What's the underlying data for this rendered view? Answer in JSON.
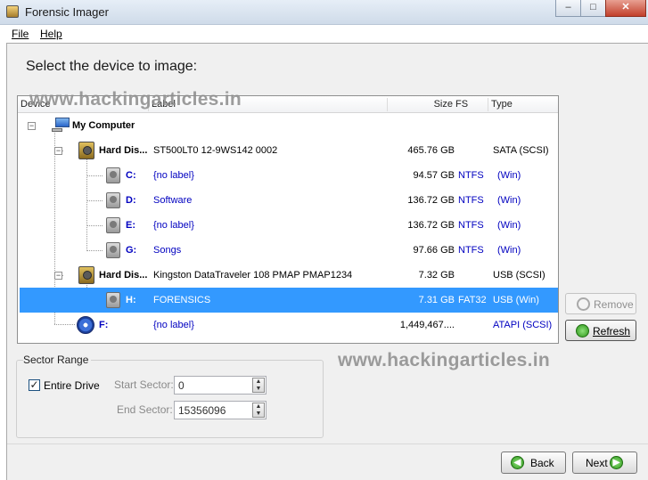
{
  "window": {
    "title": "Forensic Imager",
    "minimize": "–",
    "maximize": "□",
    "close": "✕"
  },
  "menu": {
    "file": "File",
    "help": "Help"
  },
  "heading": "Select the device to image:",
  "list": {
    "columns": {
      "device": "Device",
      "label": "Label",
      "size": "Size",
      "fs": "FS",
      "type": "Type"
    },
    "rows": [
      {
        "device": "My Computer",
        "label": "",
        "size": "",
        "fs": "",
        "type": "",
        "icon": "computer-icon",
        "expander": "−"
      },
      {
        "device": "Hard Dis...",
        "label": "ST500LT0 12-9WS142 0002",
        "size": "465.76 GB",
        "fs": "",
        "type": "SATA (SCSI)",
        "icon": "hard-disk-icon",
        "expander": "−"
      },
      {
        "device": "C:",
        "label": "{no label}",
        "size": "94.57 GB",
        "fs": "NTFS",
        "type": "(Win)",
        "icon": "volume-icon"
      },
      {
        "device": "D:",
        "label": "Software",
        "size": "136.72 GB",
        "fs": "NTFS",
        "type": "(Win)",
        "icon": "volume-icon"
      },
      {
        "device": "E:",
        "label": "{no label}",
        "size": "136.72 GB",
        "fs": "NTFS",
        "type": "(Win)",
        "icon": "volume-icon"
      },
      {
        "device": "G:",
        "label": "Songs",
        "size": "97.66 GB",
        "fs": "NTFS",
        "type": "(Win)",
        "icon": "volume-icon"
      },
      {
        "device": "Hard Dis...",
        "label": "Kingston DataTraveler 108 PMAP PMAP1234",
        "size": "7.32 GB",
        "fs": "",
        "type": "USB (SCSI)",
        "icon": "hard-disk-icon",
        "expander": "−"
      },
      {
        "device": "H:",
        "label": "FORENSICS",
        "size": "7.31 GB",
        "fs": "FAT32",
        "type": "USB (Win)",
        "icon": "volume-icon",
        "selected": true
      },
      {
        "device": "F:",
        "label": "{no label}",
        "size": "1,449,467....",
        "fs": "",
        "type": "ATAPI (SCSI)",
        "icon": "cd-drive-icon"
      }
    ]
  },
  "buttons": {
    "remove": "Remove",
    "refresh": "Refresh",
    "back": "Back",
    "next": "Next"
  },
  "watermark": "www.hackingarticles.in",
  "sector_range": {
    "title": "Sector Range",
    "entire_drive_label": "Entire Drive",
    "entire_drive_checked": true,
    "check_mark": "✓",
    "start_label": "Start Sector:",
    "start_value": "0",
    "end_label": "End Sector:",
    "end_value": "15356096"
  },
  "icons": {
    "back_arrow": "◀",
    "next_arrow": "▶",
    "spin_up": "▲",
    "spin_down": "▼"
  }
}
